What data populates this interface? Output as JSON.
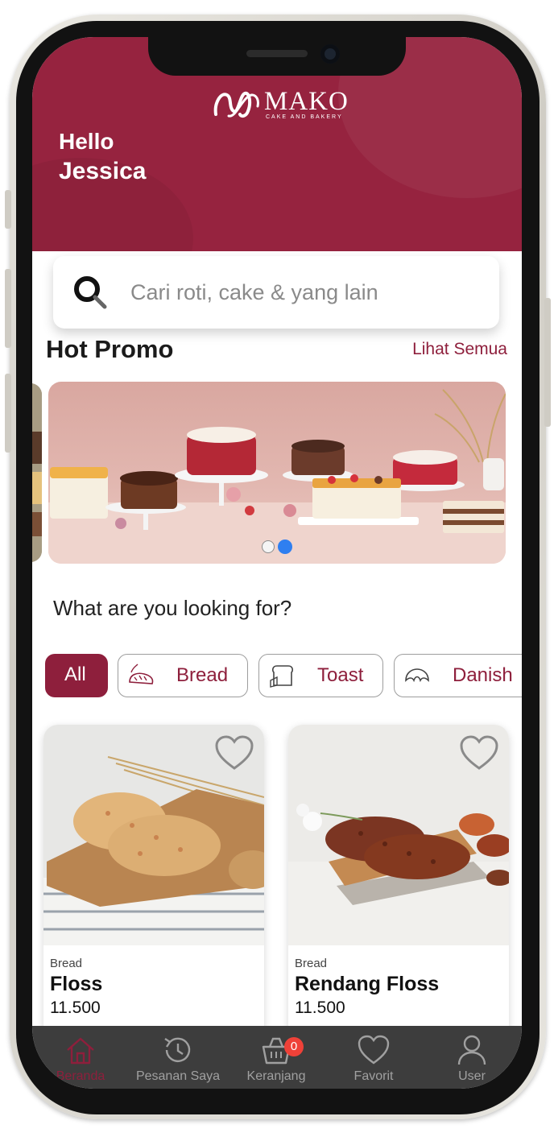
{
  "brand": {
    "name": "MAKO",
    "tagline": "CAKE AND BAKERY",
    "color": "#96233f",
    "accent": "#8e1f3c"
  },
  "greeting": {
    "hello": "Hello",
    "name": "Jessica"
  },
  "search": {
    "placeholder": "Cari roti, cake & yang lain",
    "icon": "search-icon"
  },
  "promo": {
    "title": "Hot Promo",
    "see_all": "Lihat Semua",
    "slide_count": 2,
    "active_slide": 2
  },
  "categories": {
    "prompt": "What are you looking for?",
    "items": [
      {
        "label": "All",
        "active": true
      },
      {
        "label": "Bread",
        "icon": "bread-icon"
      },
      {
        "label": "Toast",
        "icon": "toast-icon"
      },
      {
        "label": "Danish",
        "icon": "croissant-icon"
      }
    ]
  },
  "products": [
    {
      "category": "Bread",
      "name": "Floss",
      "price": "11.500"
    },
    {
      "category": "Bread",
      "name": "Rendang Floss",
      "price": "11.500"
    }
  ],
  "nav": {
    "items": [
      {
        "label": "Beranda",
        "icon": "home-icon",
        "active": true
      },
      {
        "label": "Pesanan Saya",
        "icon": "history-icon"
      },
      {
        "label": "Keranjang",
        "icon": "basket-icon",
        "badge": "0"
      },
      {
        "label": "Favorit",
        "icon": "heart-icon"
      },
      {
        "label": "User",
        "icon": "user-icon"
      }
    ]
  }
}
